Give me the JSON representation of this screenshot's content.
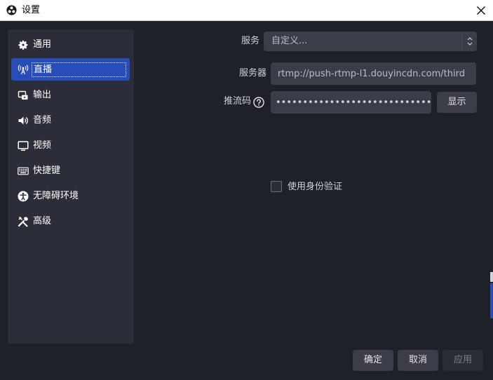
{
  "window": {
    "title": "设置"
  },
  "sidebar": {
    "items": [
      {
        "label": "通用",
        "icon": "gear-icon"
      },
      {
        "label": "直播",
        "icon": "broadcast-icon",
        "active": true
      },
      {
        "label": "输出",
        "icon": "output-icon"
      },
      {
        "label": "音频",
        "icon": "speaker-icon"
      },
      {
        "label": "视频",
        "icon": "monitor-icon"
      },
      {
        "label": "快捷键",
        "icon": "keyboard-icon"
      },
      {
        "label": "无障碍环境",
        "icon": "accessibility-icon"
      },
      {
        "label": "高级",
        "icon": "tools-icon"
      }
    ]
  },
  "stream": {
    "service_label": "服务",
    "service_value": "自定义...",
    "server_label": "服务器",
    "server_value": "rtmp://push-rtmp-l1.douyincdn.com/third",
    "key_label": "推流码",
    "key_value": "••••••••••••••••••••••••••••••",
    "show_button": "显示",
    "auth_label": "使用身份验证",
    "auth_checked": false
  },
  "footer": {
    "ok": "确定",
    "cancel": "取消",
    "apply": "应用"
  },
  "colors": {
    "background": "#1f2129",
    "panel": "#2b2e38",
    "field": "#3b3e49",
    "accent": "#284cb8"
  }
}
